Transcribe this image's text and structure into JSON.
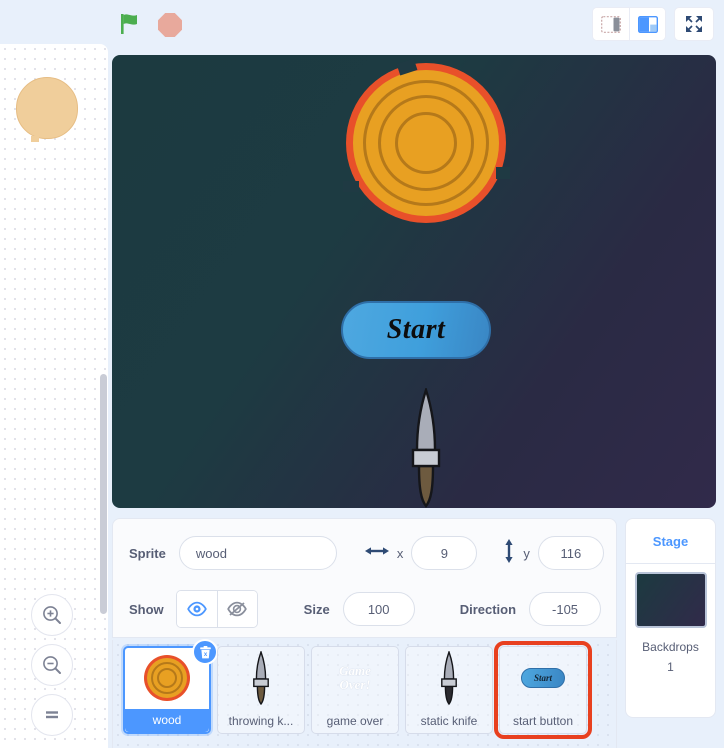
{
  "toolbar": {
    "green_flag_icon": "green-flag-icon",
    "stop_icon": "stop-sign-icon",
    "small_stage_icon": "small-stage-layout-icon",
    "large_stage_icon": "large-stage-layout-icon",
    "fullscreen_icon": "fullscreen-icon"
  },
  "workspace": {
    "zoom_in_icon": "zoom-in-icon",
    "zoom_out_icon": "zoom-out-icon",
    "zoom_reset_icon": "zoom-reset-icon"
  },
  "stage": {
    "start_button_label": "Start",
    "background_gradient_from": "#1c3a40",
    "background_gradient_to": "#312a4a"
  },
  "sprite_info": {
    "sprite_label": "Sprite",
    "sprite_name": "wood",
    "x_label": "x",
    "x_value": "9",
    "y_label": "y",
    "y_value": "116",
    "show_label": "Show",
    "size_label": "Size",
    "size_value": "100",
    "direction_label": "Direction",
    "direction_value": "-105",
    "show_icon": "eye-visible-icon",
    "hide_icon": "eye-hidden-icon",
    "x_arrow_icon": "horizontal-arrow-icon",
    "y_arrow_icon": "vertical-arrow-icon"
  },
  "sprites": [
    {
      "name": "wood",
      "selected": true,
      "highlighted": false,
      "thumb": "wood-rings-thumb",
      "delete_badge_icon": "delete-trash-icon"
    },
    {
      "name": "throwing k...",
      "selected": false,
      "highlighted": false,
      "thumb": "knife-thumb"
    },
    {
      "name": "game over",
      "selected": false,
      "highlighted": false,
      "thumb": "game-over-text-thumb",
      "thumb_text_line1": "Game",
      "thumb_text_line2": "Over!"
    },
    {
      "name": "static knife",
      "selected": false,
      "highlighted": false,
      "thumb": "knife-thumb"
    },
    {
      "name": "start button",
      "selected": false,
      "highlighted": true,
      "thumb": "start-button-thumb",
      "thumb_text": "Start"
    }
  ],
  "stage_panel": {
    "title": "Stage",
    "backdrops_label": "Backdrops",
    "backdrops_count": "1",
    "thumb": "stage-backdrop-thumb"
  },
  "colors": {
    "accent_blue": "#4c97ff",
    "highlight_red": "#e8401f",
    "text_gray": "#575e75",
    "page_bg": "#e8f0fb"
  }
}
